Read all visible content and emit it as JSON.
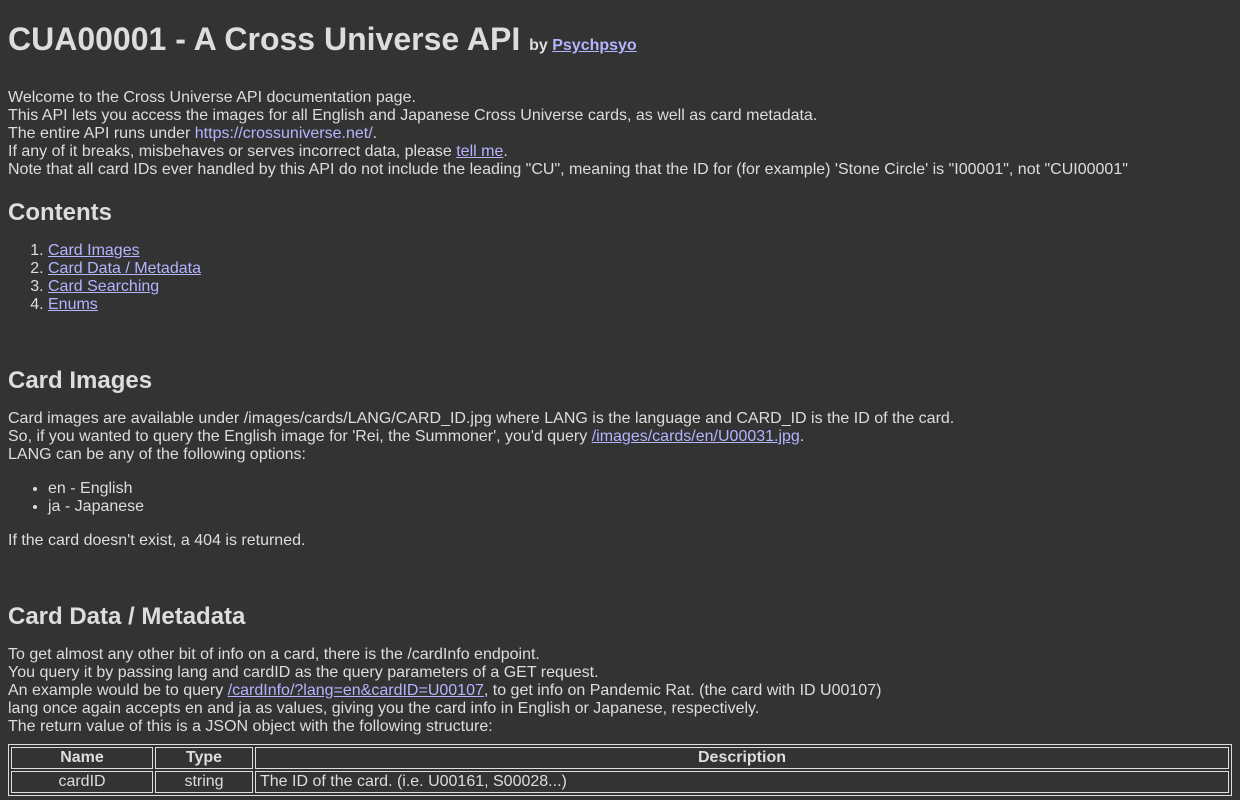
{
  "header": {
    "title": "CUA00001 - A Cross Universe API",
    "by_prefix": "by",
    "author": "Psychpsyo"
  },
  "intro": {
    "line1": "Welcome to the Cross Universe API documentation page.",
    "line2": "This API lets you access the images for all English and Japanese Cross Universe cards, as well as card metadata.",
    "line3_pre": "The entire API runs under ",
    "line3_link": "https://crossuniverse.net/",
    "line3_post": ".",
    "line4_pre": "If any of it breaks, misbehaves or serves incorrect data, please ",
    "line4_link": "tell me",
    "line4_post": ".",
    "line5": "Note that all card IDs ever handled by this API do not include the leading \"CU\", meaning that the ID for (for example) 'Stone Circle' is \"I00001\", not \"CUI00001\""
  },
  "contents": {
    "heading": "Contents",
    "items": [
      "Card Images",
      "Card Data / Metadata",
      "Card Searching",
      "Enums"
    ]
  },
  "card_images": {
    "heading": "Card Images",
    "line1": "Card images are available under /images/cards/LANG/CARD_ID.jpg where LANG is the language and CARD_ID is the ID of the card.",
    "line2_pre": "So, if you wanted to query the English image for 'Rei, the Summoner', you'd query ",
    "line2_link": "/images/cards/en/U00031.jpg",
    "line2_post": ".",
    "line3": "LANG can be any of the following options:",
    "options": [
      "en - English",
      "ja - Japanese"
    ],
    "footer": "If the card doesn't exist, a 404 is returned."
  },
  "card_data": {
    "heading": "Card Data / Metadata",
    "line1": "To get almost any other bit of info on a card, there is the /cardInfo endpoint.",
    "line2": "You query it by passing lang and cardID as the query parameters of a GET request.",
    "line3_pre": "An example would be to query ",
    "line3_link": "/cardInfo/?lang=en&cardID=U00107",
    "line3_post": ", to get info on Pandemic Rat. (the card with ID U00107)",
    "line4": "lang once again accepts en and ja as values, giving you the card info in English or Japanese, respectively.",
    "line5": "The return value of this is a JSON object with the following structure:",
    "table": {
      "headers": [
        "Name",
        "Type",
        "Description"
      ],
      "rows": [
        [
          "cardID",
          "string",
          "The ID of the card. (i.e. U00161, S00028...)"
        ]
      ]
    }
  }
}
